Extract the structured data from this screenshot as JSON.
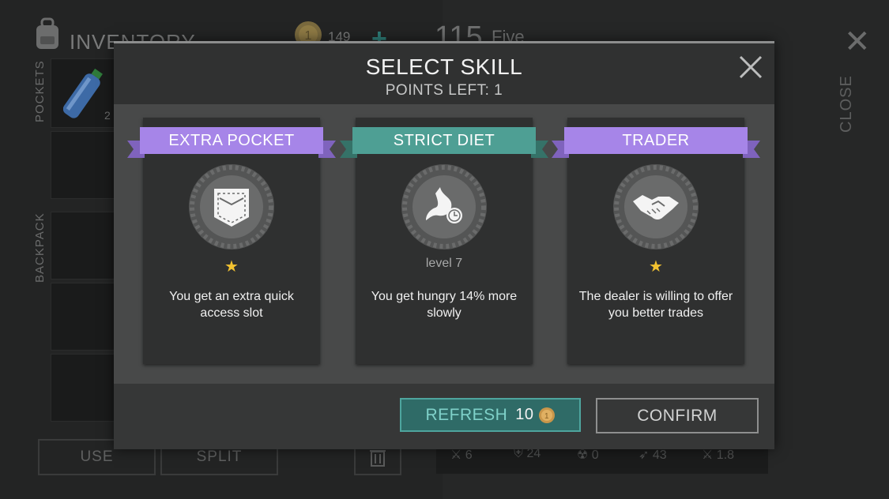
{
  "background": {
    "inventory_title": "INVENTORY",
    "coins": "149",
    "plus": "+",
    "level": "115",
    "player_name": "Five",
    "close_label": "CLOSE",
    "pockets_label": "POCKETS",
    "backpack_label": "BACKPACK",
    "bottle_count": "2",
    "use_label": "USE",
    "split_label": "SPLIT",
    "stats": [
      "6",
      "24",
      "0",
      "43",
      "1.8"
    ]
  },
  "dialog": {
    "title": "SELECT SKILL",
    "subtitle": "POINTS LEFT: 1",
    "skills": [
      {
        "name": "EXTRA POCKET",
        "ribbon_color": "#a685e8",
        "icon": "pocket-icon",
        "stars": "★",
        "description": "You get an extra quick access slot"
      },
      {
        "name": "STRICT DIET",
        "ribbon_color": "#4e9f94",
        "icon": "stomach-clock-icon",
        "level": "level 7",
        "description": "You get hungry 14% more slowly"
      },
      {
        "name": "TRADER",
        "ribbon_color": "#a685e8",
        "icon": "handshake-icon",
        "stars": "★",
        "description": "The dealer is willing to offer you better trades"
      }
    ],
    "refresh_label": "REFRESH",
    "refresh_cost": "10",
    "confirm_label": "CONFIRM"
  },
  "colors": {
    "accent_teal": "#4e9f94",
    "accent_purple": "#a685e8",
    "star": "#f2c230"
  }
}
